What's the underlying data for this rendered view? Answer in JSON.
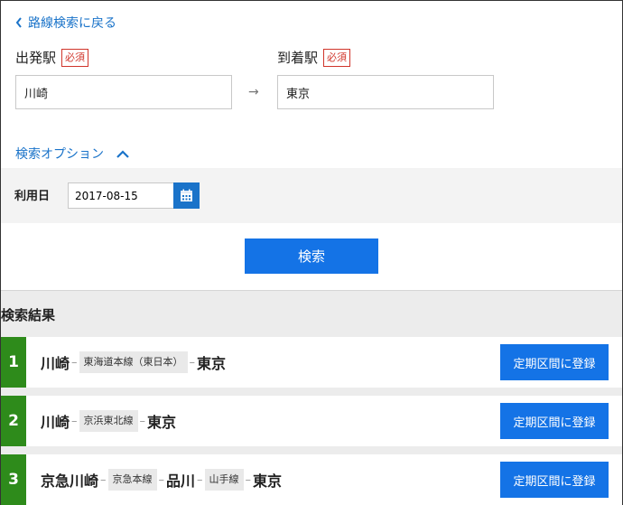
{
  "back_link": {
    "label": "路線検索に戻る"
  },
  "departure": {
    "label": "出発駅",
    "required_badge": "必須",
    "value": "川崎"
  },
  "arrow": "→",
  "arrival": {
    "label": "到着駅",
    "required_badge": "必須",
    "value": "東京"
  },
  "options": {
    "label": "検索オプション",
    "expanded": true
  },
  "date": {
    "label": "利用日",
    "value": "2017-08-15"
  },
  "search_button": {
    "label": "検索"
  },
  "results": {
    "title": "検索結果",
    "register_label": "定期区間に登録",
    "rows": [
      {
        "rank": "1",
        "stations": [
          "川崎",
          "東京"
        ],
        "lines": [
          "東海道本線（東日本）"
        ]
      },
      {
        "rank": "2",
        "stations": [
          "川崎",
          "東京"
        ],
        "lines": [
          "京浜東北線"
        ]
      },
      {
        "rank": "3",
        "stations": [
          "京急川崎",
          "品川",
          "東京"
        ],
        "lines": [
          "京急本線",
          "山手線"
        ]
      }
    ]
  },
  "colors": {
    "link": "#1a73c9",
    "primary_button": "#1473e6",
    "required": "#d0352b",
    "rank_badge": "#2e8b1b"
  }
}
